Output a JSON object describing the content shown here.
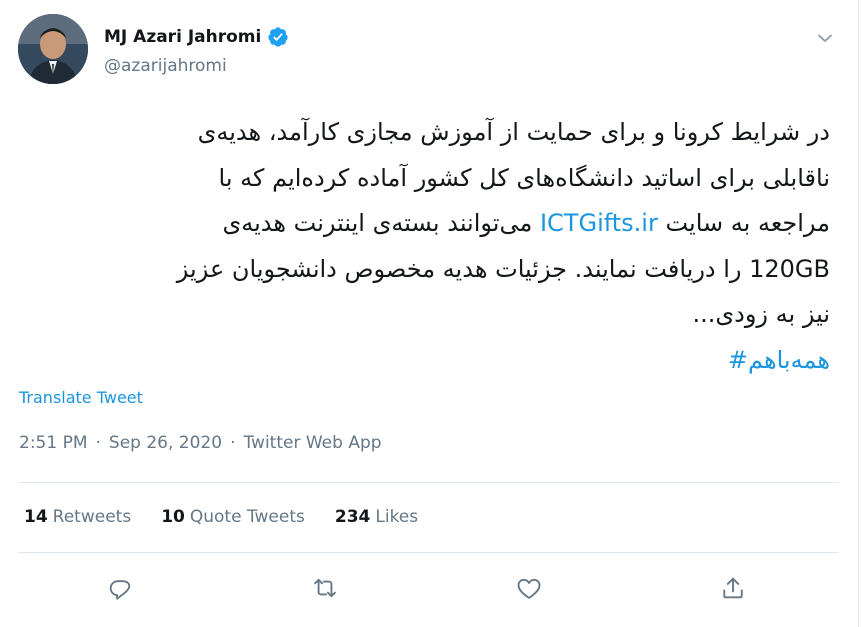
{
  "author": {
    "name": "MJ Azari Jahromi",
    "handle": "@azarijahromi",
    "verified": true
  },
  "tweet": {
    "lines": [
      {
        "text": "در شرایط کرونا و برای حمایت از آموزش مجازی کارآمد، هدیه‌ی"
      },
      {
        "text": "ناقابلی برای اساتید دانشگاه‌های کل کشور آماده کرده‌ایم که با"
      },
      {
        "before": "مراجعه به سایت ",
        "link": "ICTGifts.ir",
        "after": " می‌توانند بسته‌ی اینترنت هدیه‌ی"
      },
      {
        "text": "120GB را دریافت نمایند. جزئیات هدیه مخصوص دانشجویان عزیز"
      },
      {
        "text": "نیز به زودی..."
      }
    ],
    "hashtag": "#همه‌باهم"
  },
  "translate_label": "Translate Tweet",
  "meta": {
    "time": "2:51 PM",
    "date": "Sep 26, 2020",
    "source": "Twitter Web App",
    "separator": "·"
  },
  "stats": {
    "retweets_count": "14",
    "retweets_label": "Retweets",
    "quotes_count": "10",
    "quotes_label": "Quote Tweets",
    "likes_count": "234",
    "likes_label": "Likes"
  },
  "actions": {
    "reply_icon": "reply-icon",
    "retweet_icon": "retweet-icon",
    "like_icon": "heart-icon",
    "share_icon": "share-icon"
  },
  "colors": {
    "link": "#1b95e0",
    "secondary_text": "#657786",
    "primary_text": "#14171a",
    "divider": "#e1e8ed"
  }
}
